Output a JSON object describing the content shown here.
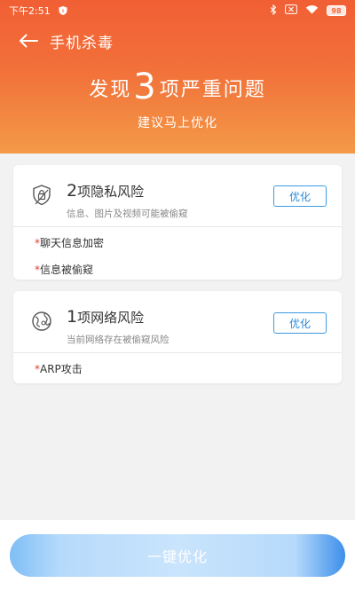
{
  "status_bar": {
    "time": "下午2:51",
    "battery": "98"
  },
  "header": {
    "title": "手机杀毒",
    "headline_prefix": "发现",
    "headline_count": "3",
    "headline_suffix": "项严重问题",
    "subtitle": "建议马上优化"
  },
  "cards": [
    {
      "count": "2",
      "title": "项隐私风险",
      "description": "信息、图片及视频可能被偷窥",
      "button_label": "优化",
      "items": [
        "聊天信息加密",
        "信息被偷窥"
      ]
    },
    {
      "count": "1",
      "title": "项网络风险",
      "description": "当前网络存在被偷窥风险",
      "button_label": "优化",
      "items": [
        "ARP攻击"
      ]
    }
  ],
  "star": "*",
  "bottom_button_label": "一键优化",
  "colors": {
    "header_top": "#f15f34",
    "header_bottom": "#f39a47",
    "accent_blue": "#2a8ad9",
    "warning_red": "#e23b2e"
  }
}
